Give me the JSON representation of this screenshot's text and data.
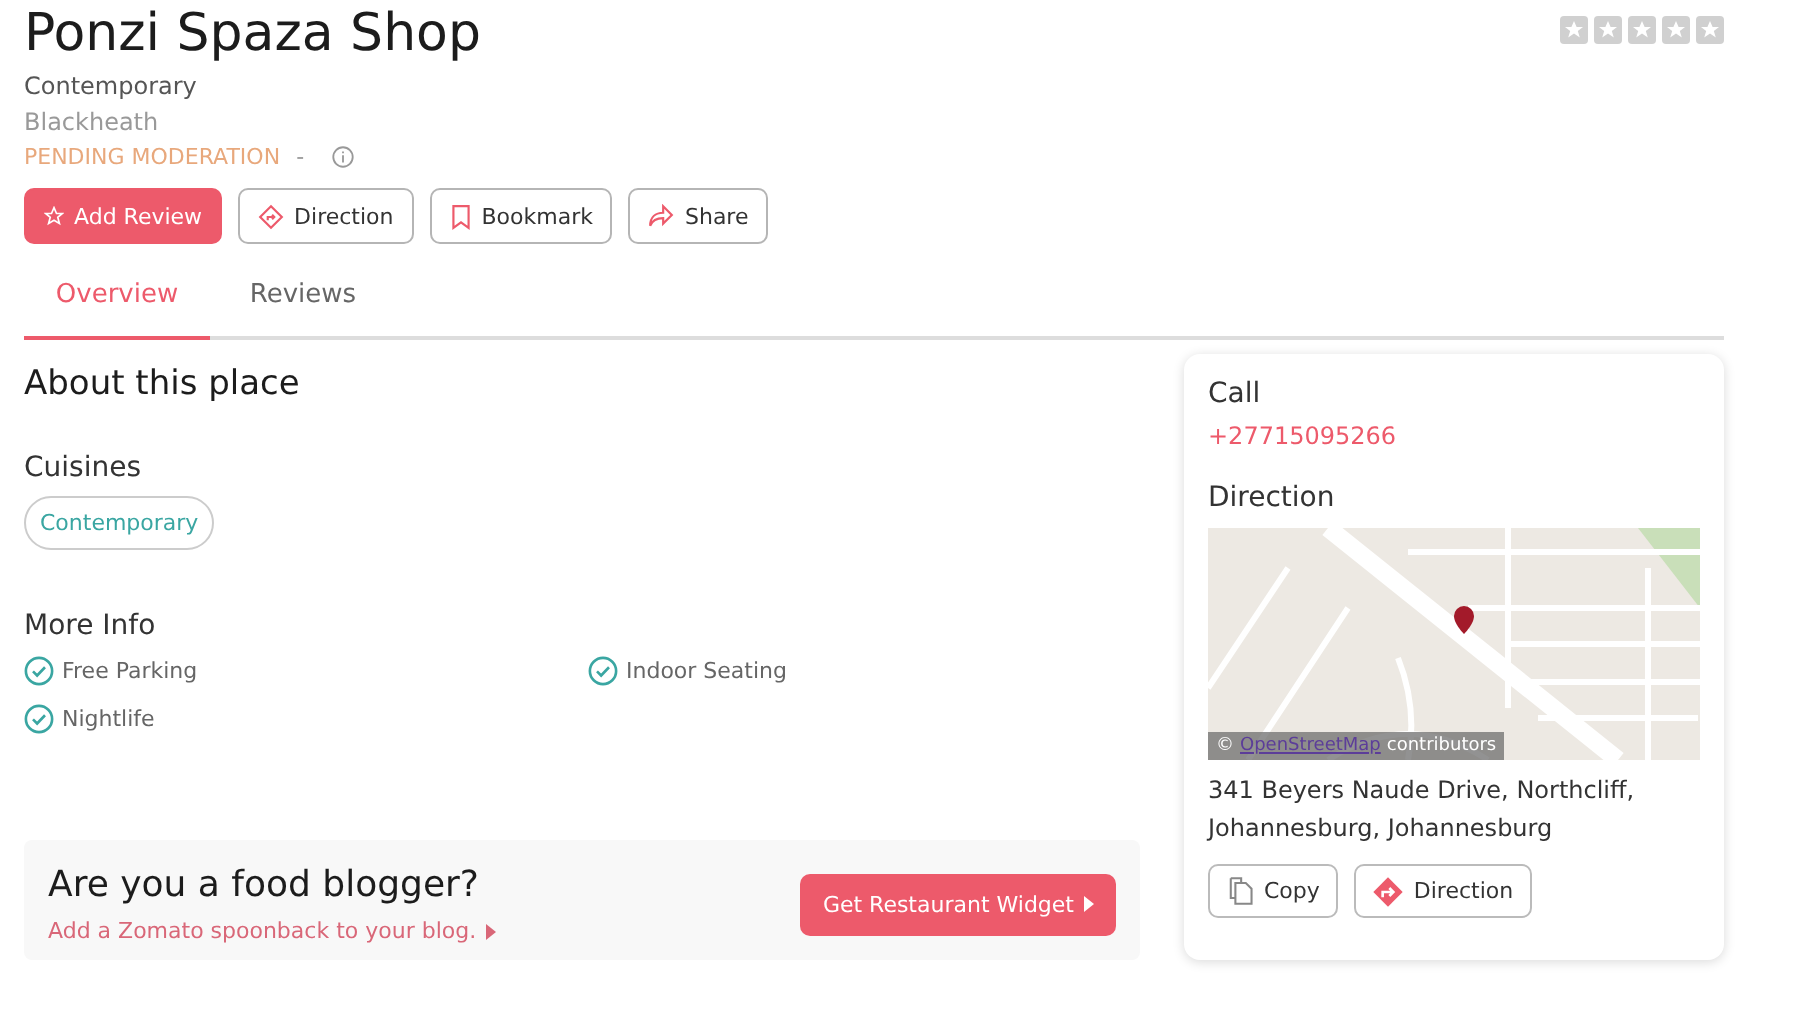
{
  "title": "Ponzi Spaza Shop",
  "rating": {
    "stars": 0
  },
  "cuisine_line": "Contemporary",
  "locality": "Blackheath",
  "status": {
    "label": "PENDING MODERATION",
    "separator": "-"
  },
  "actions": [
    {
      "label": "Add Review",
      "kind": "review"
    },
    {
      "label": "Direction",
      "kind": "direction"
    },
    {
      "label": "Bookmark",
      "kind": "bookmark"
    },
    {
      "label": "Share",
      "kind": "share"
    }
  ],
  "tabs": [
    {
      "label": "Overview",
      "selected": true
    },
    {
      "label": "Reviews",
      "selected": false
    }
  ],
  "about": {
    "heading": "About this place",
    "cuisines_heading": "Cuisines",
    "cuisines": [
      "Contemporary"
    ],
    "more_info_heading": "More Info",
    "features": [
      "Free Parking",
      "Indoor Seating",
      "Nightlife"
    ]
  },
  "blogger": {
    "heading": "Are you a food blogger?",
    "link": "Add a Zomato spoonback to your blog.",
    "button": "Get Restaurant Widget"
  },
  "sidebar": {
    "call_heading": "Call",
    "phone": "+27715095266",
    "direction_heading": "Direction",
    "map": {
      "kind": "picture",
      "attribution_symbol": "©",
      "attribution_link": "OpenStreetMap",
      "attribution_text": "contributors"
    },
    "address": "341 Beyers Naude Drive, Northcliff, Johannesburg, Johannesburg",
    "buttons": [
      {
        "label": "Copy",
        "kind": "copy"
      },
      {
        "label": "Direction",
        "kind": "direction"
      }
    ]
  }
}
